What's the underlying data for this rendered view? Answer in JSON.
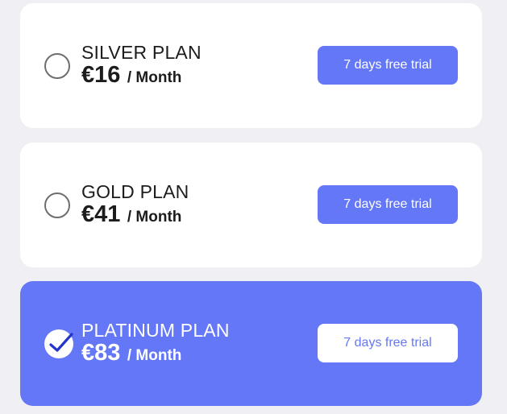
{
  "plans": [
    {
      "name": "SILVER PLAN",
      "price": "€16",
      "period": "/ Month",
      "trial_label": "7 days free trial",
      "selected": false
    },
    {
      "name": "GOLD PLAN",
      "price": "€41",
      "period": "/ Month",
      "trial_label": "7 days free trial",
      "selected": false
    },
    {
      "name": "PLATINUM PLAN",
      "price": "€83",
      "period": "/ Month",
      "trial_label": "7 days free trial",
      "selected": true
    }
  ],
  "colors": {
    "accent": "#6478f7",
    "background": "#efeff4",
    "card": "#ffffff",
    "text": "#1c1c1c",
    "check": "#2435c9"
  },
  "icons": {
    "radio_unchecked": "radio-unchecked-icon",
    "radio_checked": "checkmark-icon"
  }
}
